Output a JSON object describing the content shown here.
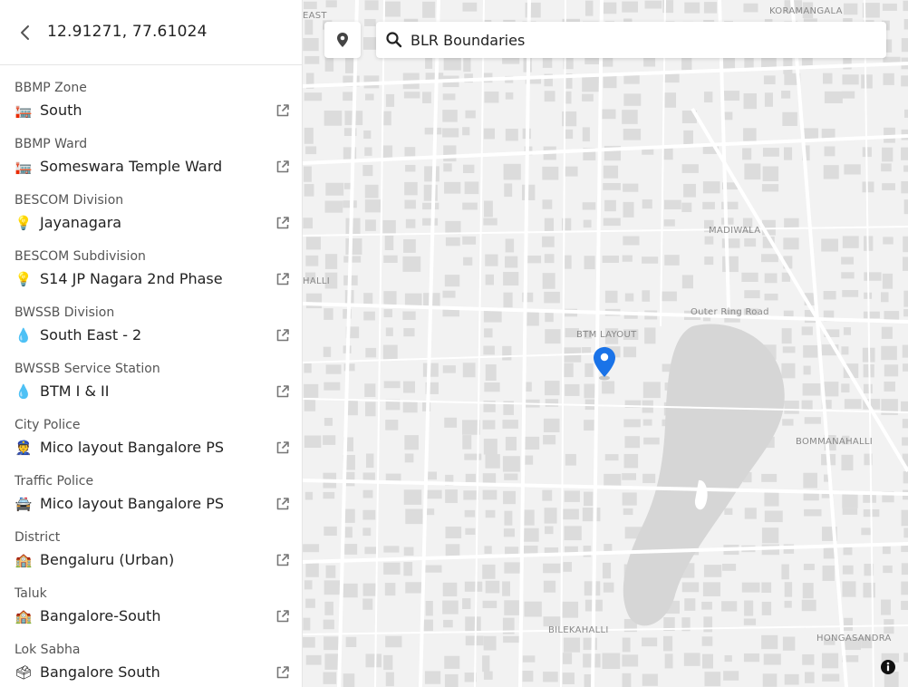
{
  "header": {
    "coordinates": "12.91271, 77.61024"
  },
  "rows": [
    {
      "label": "BBMP Zone",
      "value": "South",
      "icon": "city-hall-icon",
      "emoji": "🏣"
    },
    {
      "label": "BBMP Ward",
      "value": "Someswara Temple Ward",
      "icon": "city-hall-icon",
      "emoji": "🏣"
    },
    {
      "label": "BESCOM Division",
      "value": "Jayanagara",
      "icon": "lightbulb-icon",
      "emoji": "💡"
    },
    {
      "label": "BESCOM Subdivision",
      "value": "S14 JP Nagara 2nd Phase",
      "icon": "lightbulb-icon",
      "emoji": "💡"
    },
    {
      "label": "BWSSB Division",
      "value": "South East - 2",
      "icon": "water-drop-icon",
      "emoji": "💧"
    },
    {
      "label": "BWSSB Service Station",
      "value": "BTM I & II",
      "icon": "water-drop-icon",
      "emoji": "💧"
    },
    {
      "label": "City Police",
      "value": "Mico layout Bangalore PS",
      "icon": "police-officer-icon",
      "emoji": "👮"
    },
    {
      "label": "Traffic Police",
      "value": "Mico layout Bangalore PS",
      "icon": "police-car-icon",
      "emoji": "🚔"
    },
    {
      "label": "District",
      "value": "Bengaluru (Urban)",
      "icon": "school-building-icon",
      "emoji": "🏫"
    },
    {
      "label": "Taluk",
      "value": "Bangalore-South",
      "icon": "school-building-icon",
      "emoji": "🏫"
    },
    {
      "label": "Lok Sabha",
      "value": "Bangalore South",
      "icon": "ballot-box-icon",
      "emoji": "🗳"
    }
  ],
  "search": {
    "value": "BLR Boundaries"
  },
  "map": {
    "places": [
      {
        "name": "KORAMANGALA"
      },
      {
        "name": "EAST"
      },
      {
        "name": "MADIWALA"
      },
      {
        "name": "Outer Ring Road"
      },
      {
        "name": "BTM LAYOUT"
      },
      {
        "name": "HALLI"
      },
      {
        "name": "BOMMANAHALLI"
      },
      {
        "name": "BILEKAHALLI"
      },
      {
        "name": "HONGASANDRA"
      }
    ],
    "colors": {
      "marker": "#1a73e8",
      "land": "#f2f2f2",
      "buildings": "#dcdcdc",
      "lake": "#d6d6d6",
      "roads": "#ffffff"
    }
  }
}
